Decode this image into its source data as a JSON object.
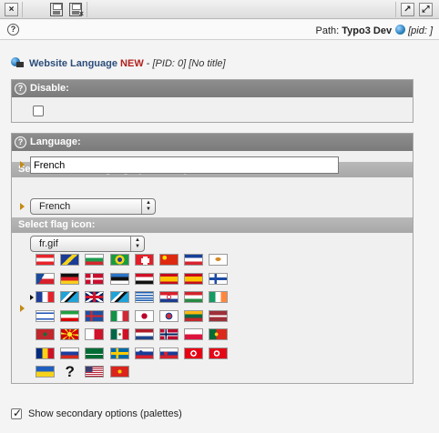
{
  "toolbar": {
    "close_label": "×",
    "expand_label": "↗",
    "fullscreen_label": "⤢",
    "save_icon": "save-icon",
    "save_close_icon": "save-and-close-icon"
  },
  "path": {
    "help_label": "?",
    "prefix": "Path: ",
    "site": "Typo3 Dev",
    "pid": "[pid: ]"
  },
  "record": {
    "table_name": "Website Language",
    "status": "NEW",
    "separator": " - ",
    "pid_info": "[PID: 0] [No title]"
  },
  "disable_section": {
    "header": "Disable:",
    "help_label": "?",
    "checked": false
  },
  "language_section": {
    "header": "Language:",
    "help_label": "?",
    "language_value": "French",
    "iso_header": "Select Official Language (ISO code):",
    "iso_value": "French",
    "flag_header": "Select flag icon:",
    "flag_value": "fr.gif",
    "selected_flag": "fr"
  },
  "flags": [
    [
      "at",
      "ba",
      "bg",
      "br",
      "ch",
      "cn",
      "cs",
      "cy"
    ],
    [
      "cz",
      "de",
      "dk",
      "ee",
      "eg",
      "es",
      "es",
      "fi"
    ],
    [
      "fr",
      "gl",
      "gb",
      "gl",
      "gr",
      "hr",
      "hu",
      "ie"
    ],
    [
      "il",
      "ir",
      "is",
      "it",
      "jp",
      "kr",
      "lt",
      "lv"
    ],
    [
      "ma",
      "mk",
      "mt",
      "mx",
      "nl",
      "no",
      "pl",
      "pt"
    ],
    [
      "ro",
      "ru",
      "sa",
      "se",
      "si",
      "sk",
      "tn",
      "tr"
    ],
    [
      "ua",
      "unknown",
      "us",
      "vn"
    ]
  ],
  "footer": {
    "checked": true,
    "label": "Show secondary options (palettes)"
  },
  "colors": {
    "header_bg": "#878787",
    "subheader_bg": "#b1b1b1",
    "new_badge": "#b0211d",
    "table_name": "#2b4d7a",
    "required_arrow": "#c48a13"
  }
}
